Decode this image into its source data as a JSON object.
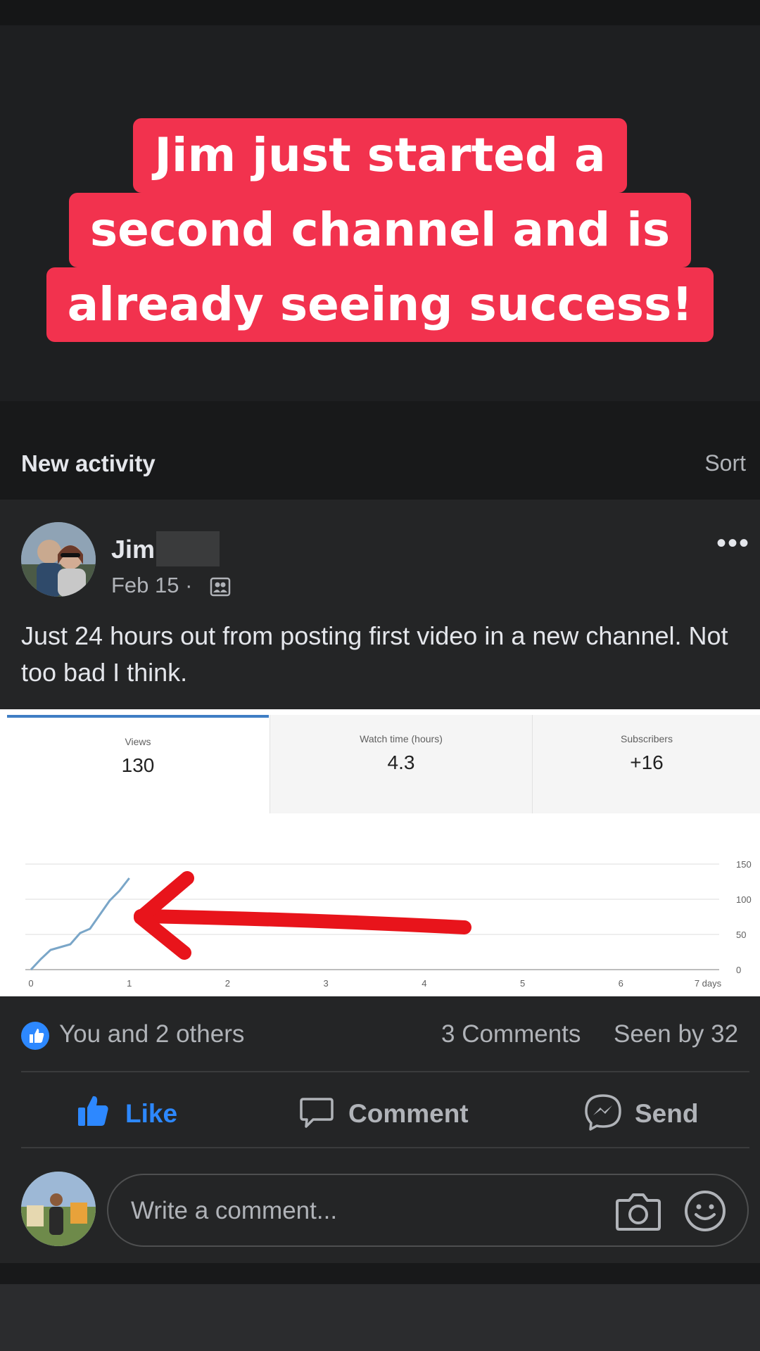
{
  "caption": {
    "lines": [
      "Jim just started a",
      "second channel and is",
      "already seeing success!"
    ]
  },
  "activity": {
    "title": "New activity",
    "sort": "Sort"
  },
  "post": {
    "author": "Jim",
    "date": "Feb 15 ·",
    "text": "Just 24 hours out from posting first video in a new channel. Not too bad I think.",
    "more_icon": "more-icon",
    "audience_icon": "group-audience-icon"
  },
  "analytics": {
    "tabs": [
      {
        "label": "Views",
        "value": "130"
      },
      {
        "label": "Watch time (hours)",
        "value": "4.3"
      },
      {
        "label": "Subscribers",
        "value": "+16"
      }
    ]
  },
  "chart_data": {
    "type": "line",
    "x_ticks": [
      "0",
      "1",
      "2",
      "3",
      "4",
      "5",
      "6",
      "7 days"
    ],
    "y_ticks": [
      "150",
      "100",
      "50",
      "0"
    ],
    "xlim": [
      0,
      7
    ],
    "ylim": [
      0,
      150
    ],
    "series": [
      {
        "x": [
          0,
          0.1,
          0.2,
          0.3,
          0.4,
          0.5,
          0.6,
          0.7,
          0.8,
          0.9,
          1.0
        ],
        "y": [
          0,
          15,
          28,
          32,
          36,
          52,
          58,
          78,
          98,
          112,
          130
        ]
      }
    ],
    "line_color": "#7aa6c8",
    "annotation": "red-arrow-pointing-left"
  },
  "stats": {
    "likes": "You and 2 others",
    "comments": "3 Comments",
    "seen": "Seen by 32"
  },
  "actions": {
    "like": "Like",
    "comment": "Comment",
    "send": "Send"
  },
  "composer": {
    "placeholder": "Write a comment..."
  },
  "colors": {
    "caption_bg": "#f2324e",
    "like_blue": "#2d88ff",
    "post_bg": "#242526"
  }
}
